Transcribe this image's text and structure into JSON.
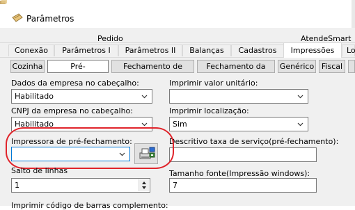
{
  "window": {
    "title": "Parâmetros"
  },
  "tabs_row1": [
    "Pedido",
    "AtendeSmart"
  ],
  "tabs_row2": [
    {
      "label": "Conexão",
      "active": false
    },
    {
      "label": "Parâmetros I",
      "active": false
    },
    {
      "label": "Parâmetros II",
      "active": false
    },
    {
      "label": "Balanças",
      "active": false
    },
    {
      "label": "Cadastros",
      "active": false
    },
    {
      "label": "Impressões",
      "active": true
    },
    {
      "label": "Lo",
      "active": false
    }
  ],
  "subtabs": [
    {
      "label": "Cozinha",
      "active": false
    },
    {
      "label": "Pré-fechamento",
      "active": true
    },
    {
      "label": "Fechamento de pedido",
      "active": false
    },
    {
      "label": "Fechamento da mesa",
      "active": false
    },
    {
      "label": "Genérico",
      "active": false
    },
    {
      "label": "Fiscal",
      "active": false
    }
  ],
  "form": {
    "dados_empresa": {
      "label": "Dados da empresa no cabeçalho:",
      "value": "Habilitado"
    },
    "imprimir_valor_unitario": {
      "label": "Imprimir valor unitário:",
      "value": ""
    },
    "cnpj_empresa": {
      "label": "CNPJ da empresa no cabeçalho:",
      "value": "Habilitado"
    },
    "imprimir_localizacao": {
      "label": "Imprimir localização:",
      "value": "Sim"
    },
    "impressora": {
      "label": "Impressora de pré-fechamento:",
      "value": ""
    },
    "descritivo_taxa": {
      "label": "Descritivo taxa de serviço(pré-fechamento):",
      "value": ""
    },
    "salto_linhas": {
      "label": "Salto de linhas",
      "value": "1"
    },
    "tamanho_fonte": {
      "label": "Tamanho fonte(Impressão windows):",
      "value": "7"
    },
    "codigo_barras": {
      "label": "Imprimir código de barras complemento:"
    }
  },
  "icons": {
    "app": "app-icon",
    "printer": "printer-select-icon"
  },
  "colors": {
    "highlight": "#e0242b",
    "focus": "#0078d7"
  }
}
